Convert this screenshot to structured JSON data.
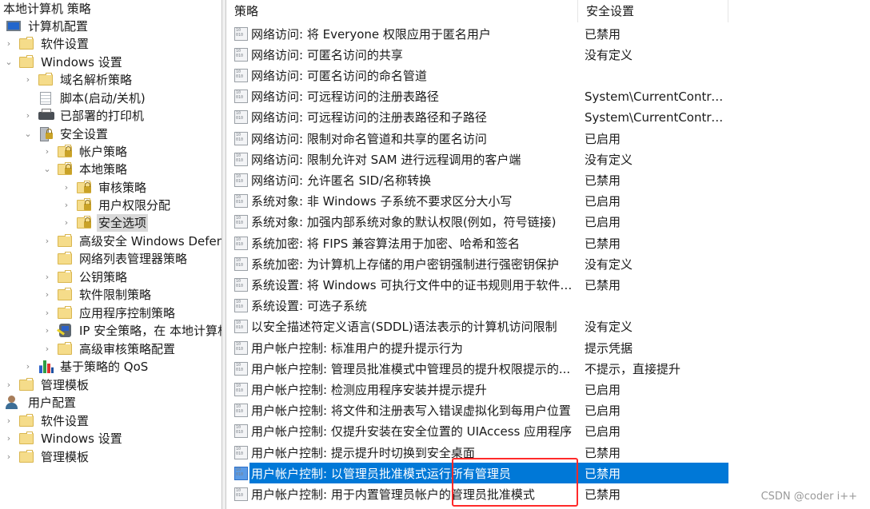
{
  "tree": {
    "root_title": "本地计算机 策略",
    "nodes": [
      {
        "label": "计算机配置",
        "icon": "computer-icon",
        "expander": "none"
      },
      {
        "label": "软件设置",
        "icon": "folder-icon",
        "expander": "collapsed"
      },
      {
        "label": "Windows 设置",
        "icon": "folder-icon",
        "expander": "expanded"
      },
      {
        "label": "域名解析策略",
        "icon": "folder-icon",
        "expander": "collapsed"
      },
      {
        "label": "脚本(启动/关机)",
        "icon": "script-icon",
        "expander": "none"
      },
      {
        "label": "已部署的打印机",
        "icon": "printer-icon",
        "expander": "collapsed"
      },
      {
        "label": "安全设置",
        "icon": "security-settings-icon",
        "expander": "expanded"
      },
      {
        "label": "帐户策略",
        "icon": "locked-folder-icon",
        "expander": "collapsed"
      },
      {
        "label": "本地策略",
        "icon": "locked-folder-icon",
        "expander": "expanded"
      },
      {
        "label": "审核策略",
        "icon": "locked-folder-icon",
        "expander": "collapsed"
      },
      {
        "label": "用户权限分配",
        "icon": "locked-folder-icon",
        "expander": "collapsed"
      },
      {
        "label": "安全选项",
        "icon": "locked-folder-icon",
        "expander": "collapsed",
        "selected": true
      },
      {
        "label": "高级安全 Windows Defenc",
        "icon": "folder-icon",
        "expander": "collapsed"
      },
      {
        "label": "网络列表管理器策略",
        "icon": "folder-icon",
        "expander": "none"
      },
      {
        "label": "公钥策略",
        "icon": "folder-icon",
        "expander": "collapsed"
      },
      {
        "label": "软件限制策略",
        "icon": "folder-icon",
        "expander": "collapsed"
      },
      {
        "label": "应用程序控制策略",
        "icon": "folder-icon",
        "expander": "collapsed"
      },
      {
        "label": "IP 安全策略，在 本地计算机",
        "icon": "ipsec-icon",
        "expander": "collapsed"
      },
      {
        "label": "高级审核策略配置",
        "icon": "folder-icon",
        "expander": "collapsed"
      },
      {
        "label": "基于策略的 QoS",
        "icon": "qos-chart-icon",
        "expander": "collapsed"
      },
      {
        "label": "管理模板",
        "icon": "folder-icon",
        "expander": "collapsed"
      },
      {
        "label": "用户配置",
        "icon": "user-icon",
        "expander": "none"
      },
      {
        "label": "软件设置",
        "icon": "folder-icon",
        "expander": "collapsed"
      },
      {
        "label": "Windows 设置",
        "icon": "folder-icon",
        "expander": "collapsed"
      },
      {
        "label": "管理模板",
        "icon": "folder-icon",
        "expander": "collapsed"
      }
    ]
  },
  "list": {
    "columns": {
      "policy": "策略",
      "setting": "安全设置"
    },
    "rows": [
      {
        "policy": "网络访问: 将 Everyone 权限应用于匿名用户",
        "setting": "已禁用"
      },
      {
        "policy": "网络访问: 可匿名访问的共享",
        "setting": "没有定义"
      },
      {
        "policy": "网络访问: 可匿名访问的命名管道",
        "setting": ""
      },
      {
        "policy": "网络访问: 可远程访问的注册表路径",
        "setting": "System\\CurrentControl..."
      },
      {
        "policy": "网络访问: 可远程访问的注册表路径和子路径",
        "setting": "System\\CurrentControl..."
      },
      {
        "policy": "网络访问: 限制对命名管道和共享的匿名访问",
        "setting": "已启用"
      },
      {
        "policy": "网络访问: 限制允许对 SAM 进行远程调用的客户端",
        "setting": "没有定义"
      },
      {
        "policy": "网络访问: 允许匿名 SID/名称转换",
        "setting": "已禁用"
      },
      {
        "policy": "系统对象: 非 Windows 子系统不要求区分大小写",
        "setting": "已启用"
      },
      {
        "policy": "系统对象: 加强内部系统对象的默认权限(例如，符号链接)",
        "setting": "已启用"
      },
      {
        "policy": "系统加密: 将 FIPS 兼容算法用于加密、哈希和签名",
        "setting": "已禁用"
      },
      {
        "policy": "系统加密: 为计算机上存储的用户密钥强制进行强密钥保护",
        "setting": "没有定义"
      },
      {
        "policy": "系统设置: 将 Windows 可执行文件中的证书规则用于软件限...",
        "setting": "已禁用"
      },
      {
        "policy": "系统设置: 可选子系统",
        "setting": ""
      },
      {
        "policy": "以安全描述符定义语言(SDDL)语法表示的计算机访问限制",
        "setting": "没有定义"
      },
      {
        "policy": "用户帐户控制: 标准用户的提升提示行为",
        "setting": "提示凭据"
      },
      {
        "policy": "用户帐户控制: 管理员批准模式中管理员的提升权限提示的...",
        "setting": "不提示，直接提升"
      },
      {
        "policy": "用户帐户控制: 检测应用程序安装并提示提升",
        "setting": "已启用"
      },
      {
        "policy": "用户帐户控制: 将文件和注册表写入错误虚拟化到每用户位置",
        "setting": "已启用"
      },
      {
        "policy": "用户帐户控制: 仅提升安装在安全位置的 UIAccess 应用程序",
        "setting": "已启用"
      },
      {
        "policy": "用户帐户控制: 提示提升时切换到安全桌面",
        "setting": "已禁用"
      },
      {
        "policy": "用户帐户控制: 以管理员批准模式运行所有管理员",
        "setting": "已禁用",
        "selected": true
      },
      {
        "policy": "用户帐户控制: 用于内置管理员帐户的管理员批准模式",
        "setting": "已禁用"
      }
    ]
  },
  "annotation": {
    "color": "#ff2a2a"
  },
  "colors": {
    "selection": "#0078d7"
  },
  "watermark": "CSDN @coder i++"
}
